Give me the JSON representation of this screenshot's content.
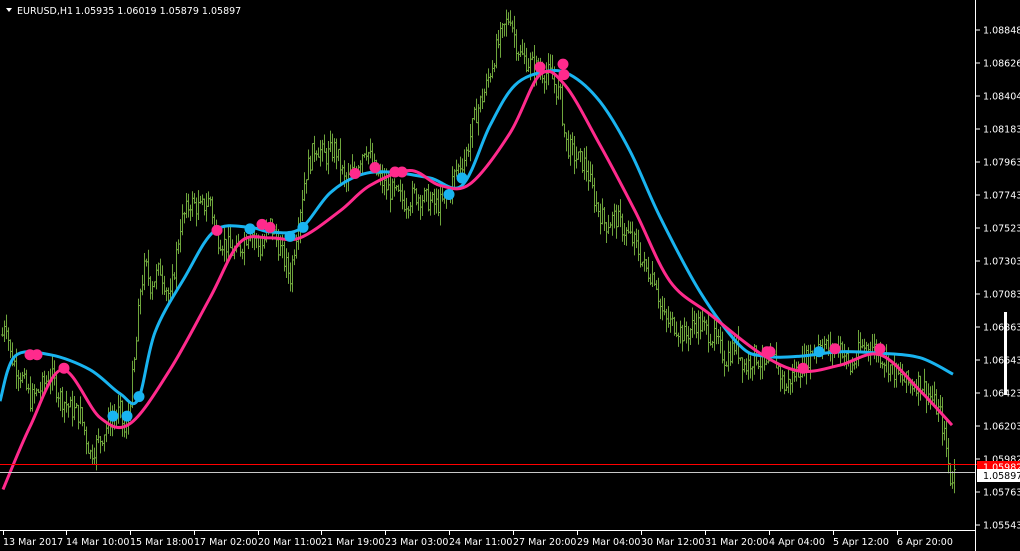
{
  "header": {
    "symbol": "EURUSD,H1",
    "ohlc": "1.05935 1.06019 1.05879 1.05897"
  },
  "price_axis": {
    "ticks": [
      "1.08848",
      "1.08626",
      "1.08404",
      "1.08183",
      "1.07963",
      "1.07743",
      "1.07523",
      "1.07303",
      "1.07083",
      "1.06863",
      "1.06643",
      "1.06423",
      "1.06203",
      "1.05982",
      "1.05763",
      "1.05543"
    ],
    "current_price": "1.05897",
    "alert_level_label": "1.05982"
  },
  "time_axis": {
    "ticks": [
      "13 Mar 2017",
      "14 Mar 10:00",
      "15 Mar 18:00",
      "17 Mar 02:00",
      "20 Mar 11:00",
      "21 Mar 19:00",
      "23 Mar 03:00",
      "24 Mar 11:00",
      "27 Mar 20:00",
      "29 Mar 04:00",
      "30 Mar 12:00",
      "31 Mar 20:00",
      "4 Apr 04:00",
      "5 Apr 12:00",
      "6 Apr 20:00"
    ]
  },
  "colors": {
    "background": "#000000",
    "bars": "#6ea53c",
    "fast_ma": "#19b4f0",
    "slow_ma": "#ff2a8c",
    "signal_line": "#ffff00",
    "alert_line": "#ff0000",
    "current_line": "#c8c8c8",
    "text": "#ffffff"
  },
  "chart_data": {
    "type": "line",
    "ylim": [
      1.0554,
      1.0898
    ],
    "price_series_close": [
      [
        0,
        1.0672
      ],
      [
        5,
        1.0695
      ],
      [
        10,
        1.0668
      ],
      [
        20,
        1.0655
      ],
      [
        30,
        1.0638
      ],
      [
        40,
        1.0645
      ],
      [
        50,
        1.0655
      ],
      [
        60,
        1.064
      ],
      [
        70,
        1.0632
      ],
      [
        80,
        1.0628
      ],
      [
        90,
        1.0602
      ],
      [
        100,
        1.0612
      ],
      [
        110,
        1.0625
      ],
      [
        120,
        1.063
      ],
      [
        125,
        1.0612
      ],
      [
        130,
        1.064
      ],
      [
        135,
        1.0668
      ],
      [
        140,
        1.0712
      ],
      [
        145,
        1.0728
      ],
      [
        150,
        1.0715
      ],
      [
        160,
        1.0725
      ],
      [
        170,
        1.0705
      ],
      [
        180,
        1.0755
      ],
      [
        190,
        1.077
      ],
      [
        200,
        1.0765
      ],
      [
        210,
        1.0772
      ],
      [
        215,
        1.0748
      ],
      [
        225,
        1.0742
      ],
      [
        235,
        1.0735
      ],
      [
        240,
        1.074
      ],
      [
        250,
        1.0752
      ],
      [
        260,
        1.0738
      ],
      [
        270,
        1.0755
      ],
      [
        280,
        1.0738
      ],
      [
        290,
        1.072
      ],
      [
        295,
        1.0745
      ],
      [
        305,
        1.0788
      ],
      [
        315,
        1.0808
      ],
      [
        325,
        1.08
      ],
      [
        335,
        1.0806
      ],
      [
        345,
        1.0782
      ],
      [
        355,
        1.0792
      ],
      [
        365,
        1.0808
      ],
      [
        375,
        1.079
      ],
      [
        385,
        1.078
      ],
      [
        395,
        1.0775
      ],
      [
        405,
        1.077
      ],
      [
        415,
        1.0775
      ],
      [
        425,
        1.0772
      ],
      [
        435,
        1.0768
      ],
      [
        445,
        1.077
      ],
      [
        455,
        1.079
      ],
      [
        465,
        1.08
      ],
      [
        475,
        1.0828
      ],
      [
        485,
        1.0845
      ],
      [
        495,
        1.087
      ],
      [
        505,
        1.0888
      ],
      [
        510,
        1.0895
      ],
      [
        515,
        1.0878
      ],
      [
        520,
        1.0868
      ],
      [
        530,
        1.0862
      ],
      [
        540,
        1.0858
      ],
      [
        550,
        1.0855
      ],
      [
        560,
        1.084
      ],
      [
        565,
        1.081
      ],
      [
        575,
        1.08
      ],
      [
        585,
        1.0795
      ],
      [
        595,
        1.077
      ],
      [
        605,
        1.0755
      ],
      [
        615,
        1.076
      ],
      [
        625,
        1.075
      ],
      [
        635,
        1.0742
      ],
      [
        645,
        1.0725
      ],
      [
        655,
        1.072
      ],
      [
        660,
        1.07
      ],
      [
        665,
        1.069
      ],
      [
        675,
        1.0688
      ],
      [
        685,
        1.068
      ],
      [
        695,
        1.069
      ],
      [
        705,
        1.0685
      ],
      [
        715,
        1.0678
      ],
      [
        725,
        1.0665
      ],
      [
        735,
        1.0675
      ],
      [
        745,
        1.066
      ],
      [
        755,
        1.0668
      ],
      [
        765,
        1.0658
      ],
      [
        775,
        1.0665
      ],
      [
        785,
        1.0645
      ],
      [
        790,
        1.0652
      ],
      [
        800,
        1.066
      ],
      [
        810,
        1.0668
      ],
      [
        820,
        1.0678
      ],
      [
        830,
        1.067
      ],
      [
        840,
        1.0675
      ],
      [
        850,
        1.0658
      ],
      [
        860,
        1.0672
      ],
      [
        870,
        1.0675
      ],
      [
        880,
        1.0668
      ],
      [
        890,
        1.066
      ],
      [
        900,
        1.0652
      ],
      [
        910,
        1.0648
      ],
      [
        920,
        1.065
      ],
      [
        930,
        1.064
      ],
      [
        940,
        1.0628
      ],
      [
        945,
        1.061
      ],
      [
        950,
        1.0585
      ],
      [
        955,
        1.059
      ]
    ],
    "series": [
      {
        "values": [
          [
            0,
            1.0637
          ],
          [
            15,
            1.0667
          ],
          [
            50,
            1.0668
          ],
          [
            90,
            1.0658
          ],
          [
            120,
            1.0642
          ],
          [
            138,
            1.0638
          ],
          [
            155,
            1.0683
          ],
          [
            185,
            1.072
          ],
          [
            215,
            1.0751
          ],
          [
            250,
            1.0753
          ],
          [
            270,
            1.075
          ],
          [
            300,
            1.0752
          ],
          [
            330,
            1.0776
          ],
          [
            360,
            1.0788
          ],
          [
            390,
            1.079
          ],
          [
            430,
            1.0786
          ],
          [
            462,
            1.0781
          ],
          [
            490,
            1.0821
          ],
          [
            515,
            1.0848
          ],
          [
            545,
            1.0857
          ],
          [
            570,
            1.0855
          ],
          [
            600,
            1.0837
          ],
          [
            630,
            1.0804
          ],
          [
            660,
            1.076
          ],
          [
            700,
            1.071
          ],
          [
            740,
            1.0674
          ],
          [
            765,
            1.0667
          ],
          [
            800,
            1.0667
          ],
          [
            840,
            1.067
          ],
          [
            880,
            1.0669
          ],
          [
            920,
            1.0666
          ],
          [
            953,
            1.0655
          ]
        ]
      },
      {
        "values": [
          [
            3,
            1.0578
          ],
          [
            30,
            1.062
          ],
          [
            62,
            1.0658
          ],
          [
            100,
            1.0626
          ],
          [
            130,
            1.0622
          ],
          [
            170,
            1.0658
          ],
          [
            210,
            1.0706
          ],
          [
            240,
            1.0743
          ],
          [
            270,
            1.0746
          ],
          [
            300,
            1.0746
          ],
          [
            340,
            1.0764
          ],
          [
            370,
            1.0781
          ],
          [
            410,
            1.0791
          ],
          [
            440,
            1.0781
          ],
          [
            470,
            1.0782
          ],
          [
            510,
            1.0816
          ],
          [
            540,
            1.0855
          ],
          [
            565,
            1.0848
          ],
          [
            600,
            1.0808
          ],
          [
            635,
            1.0764
          ],
          [
            670,
            1.0717
          ],
          [
            710,
            1.0695
          ],
          [
            760,
            1.0669
          ],
          [
            800,
            1.0657
          ],
          [
            840,
            1.0661
          ],
          [
            880,
            1.0668
          ],
          [
            920,
            1.0644
          ],
          [
            952,
            1.0621
          ]
        ]
      }
    ],
    "markers_fast": [
      [
        113,
        1.0627
      ],
      [
        127,
        1.0627
      ],
      [
        139,
        1.064
      ],
      [
        250,
        1.0752
      ],
      [
        290,
        1.0747
      ],
      [
        303,
        1.0753
      ],
      [
        449,
        1.0775
      ],
      [
        462,
        1.0786
      ],
      [
        819,
        1.067
      ]
    ],
    "markers_slow": [
      [
        30,
        1.0668
      ],
      [
        37,
        1.0668
      ],
      [
        64,
        1.0659
      ],
      [
        217,
        1.0751
      ],
      [
        262,
        1.0755
      ],
      [
        270,
        1.0753
      ],
      [
        355,
        1.0789
      ],
      [
        375,
        1.0793
      ],
      [
        395,
        1.079
      ],
      [
        402,
        1.079
      ],
      [
        540,
        1.086
      ],
      [
        563,
        1.0862
      ],
      [
        564,
        1.0855
      ],
      [
        767,
        1.067
      ],
      [
        770,
        1.067
      ],
      [
        803,
        1.0659
      ],
      [
        835,
        1.0672
      ],
      [
        880,
        1.0672
      ]
    ],
    "alert_level": 1.05947,
    "current_value": 1.05897
  }
}
